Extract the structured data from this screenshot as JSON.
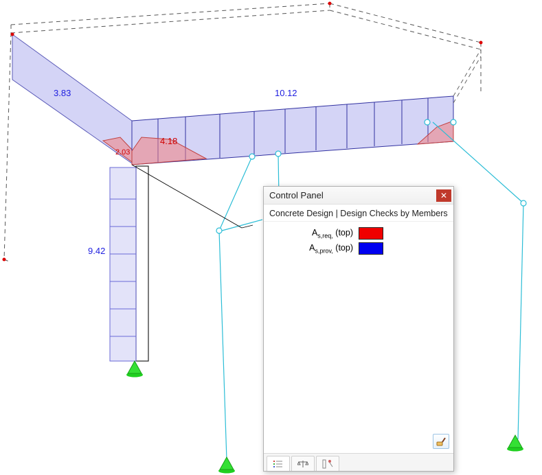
{
  "panel": {
    "title": "Control Panel",
    "subtitle": "Concrete Design | Design Checks by Members",
    "legend": [
      {
        "key": "as_req_top",
        "label_main": "A",
        "label_sub": "s,req,",
        "label_suffix": " (top)",
        "color": "red"
      },
      {
        "key": "as_prov_top",
        "label_main": "A",
        "label_sub": "s,prov,",
        "label_suffix": " (top)",
        "color": "blue"
      }
    ]
  },
  "dimensions": {
    "d1": "3.83",
    "d2": "10.12",
    "d3": "4.18",
    "d4": "2.03",
    "d5": "9.42"
  },
  "icons": {
    "close": "x",
    "tabs": [
      "legend",
      "balance",
      "filters"
    ]
  }
}
